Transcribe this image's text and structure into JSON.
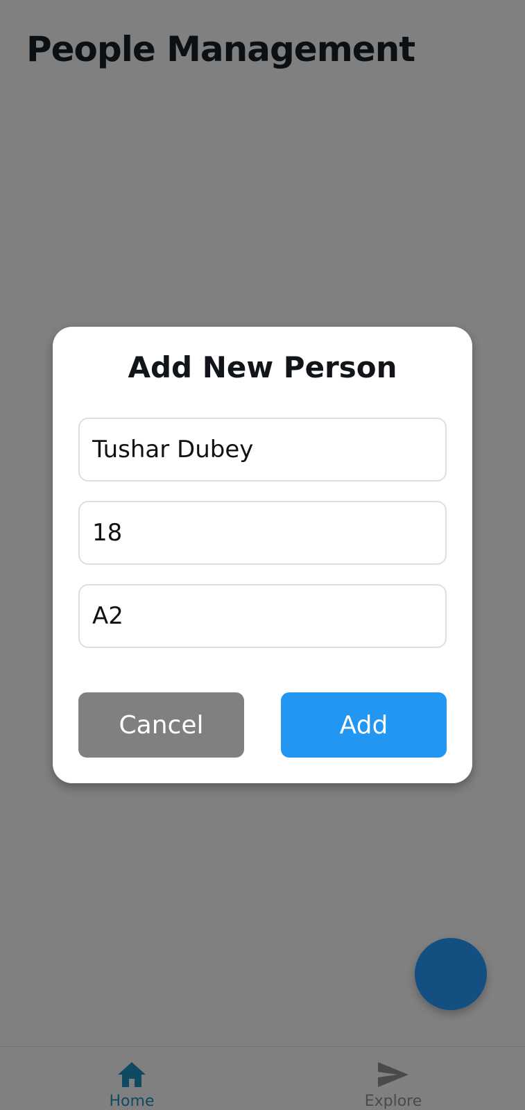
{
  "header": {
    "title": "People Management"
  },
  "dialog": {
    "title": "Add New Person",
    "fields": {
      "name": {
        "value": "Tushar Dubey"
      },
      "age": {
        "value": "18"
      },
      "class": {
        "value": "A2"
      }
    },
    "cancel_label": "Cancel",
    "add_label": "Add"
  },
  "bottom_nav": {
    "items": [
      {
        "label": "Home",
        "icon": "home-icon",
        "active": true
      },
      {
        "label": "Explore",
        "icon": "send-icon",
        "active": false
      }
    ]
  },
  "fab": {
    "icon": "add-icon"
  },
  "colors": {
    "overlay": "#808080",
    "primary": "#2196f3",
    "fab": "#134f80",
    "active_nav": "#0f4a62",
    "inactive_nav": "#4a4a4a"
  }
}
